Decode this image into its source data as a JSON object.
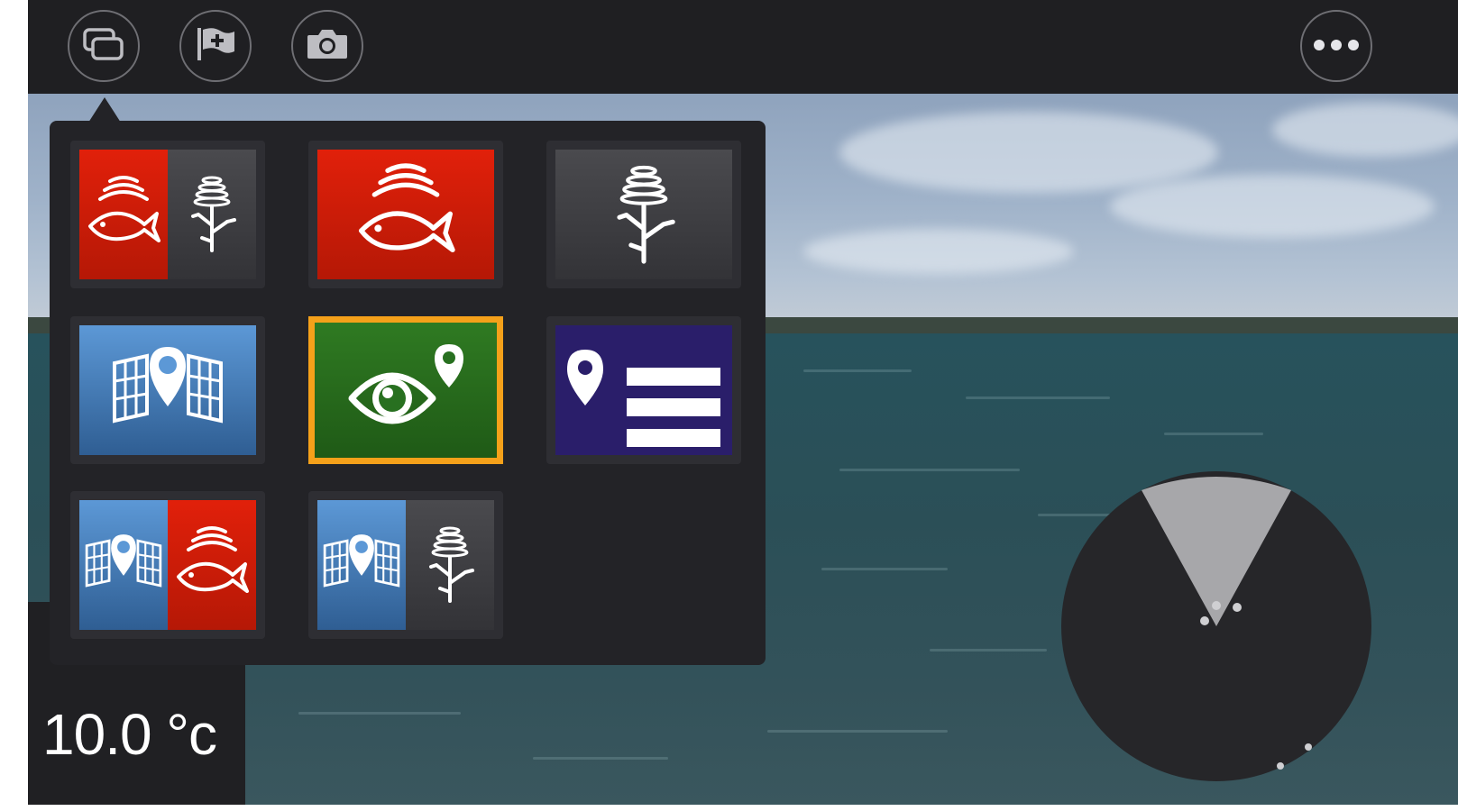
{
  "toolbar": {
    "buttons": [
      {
        "name": "switch-apps-button",
        "icon": "windows-icon"
      },
      {
        "name": "add-waypoint-button",
        "icon": "flag-plus-icon"
      },
      {
        "name": "screenshot-button",
        "icon": "camera-icon"
      },
      {
        "name": "more-options-button",
        "icon": "more-dots-icon"
      }
    ]
  },
  "app_menu": {
    "tiles": [
      {
        "name": "tile-fishfinder-sonar-split",
        "icons": [
          "fish-sonar-icon",
          "tree-sonar-icon"
        ],
        "colors": [
          "#d11c08",
          "#3e3e42"
        ]
      },
      {
        "name": "tile-fishfinder",
        "icons": [
          "fish-sonar-icon"
        ],
        "colors": [
          "#d11c08"
        ]
      },
      {
        "name": "tile-sidevision-sonar",
        "icons": [
          "tree-sonar-icon"
        ],
        "colors": [
          "#3e3e42"
        ]
      },
      {
        "name": "tile-chart",
        "icons": [
          "chart-pin-icon"
        ],
        "colors": [
          "#4a84c4"
        ]
      },
      {
        "name": "tile-camera-ar",
        "icons": [
          "eye-pin-icon"
        ],
        "colors": [
          "#287020"
        ],
        "selected": true
      },
      {
        "name": "tile-waypoint-list",
        "icons": [
          "pin-list-icon"
        ],
        "colors": [
          "#2a1e6a"
        ]
      },
      {
        "name": "tile-chart-fishfinder-split",
        "icons": [
          "chart-pin-icon",
          "fish-sonar-icon"
        ],
        "colors": [
          "#4a84c4",
          "#d11c08"
        ]
      },
      {
        "name": "tile-chart-sonar-split",
        "icons": [
          "chart-pin-icon",
          "tree-sonar-icon"
        ],
        "colors": [
          "#4a84c4",
          "#3e3e42"
        ]
      }
    ],
    "selection_color": "#f5a11a"
  },
  "data_overlay": {
    "temperature": "10.0 °c"
  },
  "radar_widget": {
    "icon": "field-of-view-icon"
  }
}
